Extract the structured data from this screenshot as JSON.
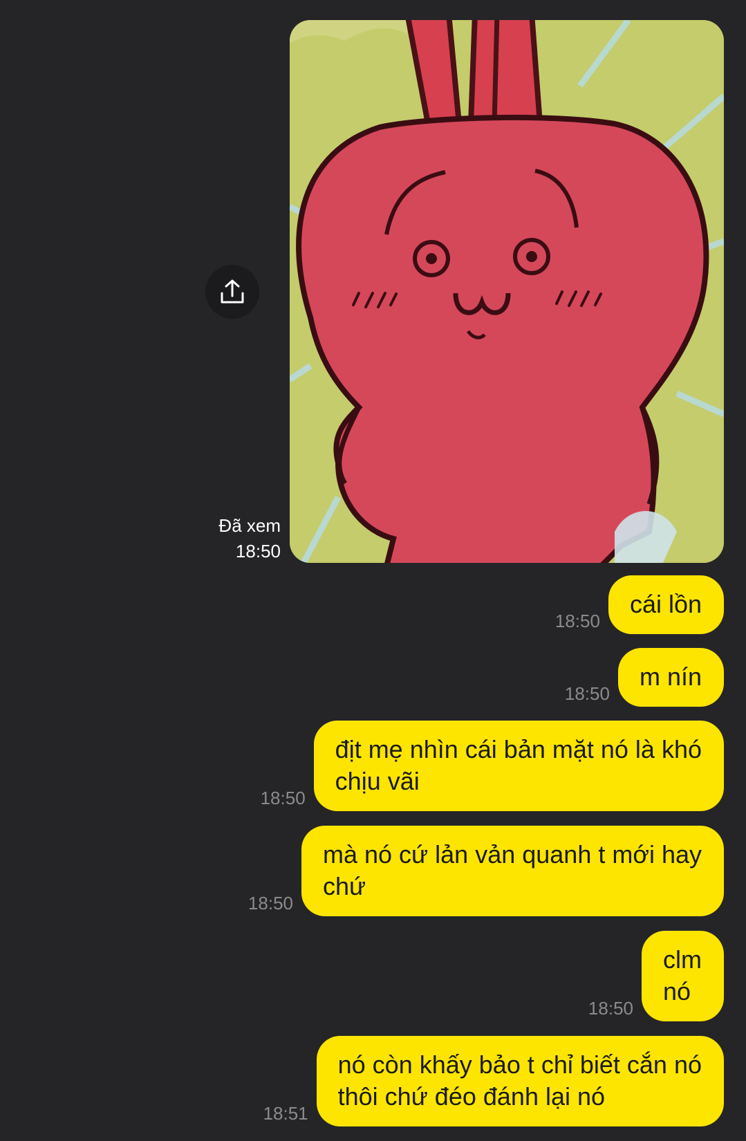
{
  "image_message": {
    "image_alt": "red cartoon bunny sticker on green background",
    "seen_label": "Đã xem",
    "time": "18:50"
  },
  "messages": [
    {
      "lines": [
        "cái lồn"
      ],
      "time": "18:50"
    },
    {
      "lines": [
        "m nín"
      ],
      "time": "18:50"
    },
    {
      "lines": [
        "địt mẹ nhìn cái bản mặt nó là khó",
        "chịu vãi"
      ],
      "time": "18:50"
    },
    {
      "lines": [
        "mà nó cứ lản vản quanh t mới hay",
        "chứ"
      ],
      "time": "18:50"
    },
    {
      "lines": [
        "clm",
        "nó"
      ],
      "time": "18:50"
    },
    {
      "lines": [
        "nó còn khấy bảo t chỉ biết cắn nó",
        "thôi chứ đéo đánh lại nó"
      ],
      "time": "18:51"
    }
  ],
  "icons": {
    "share": "share-upload-icon"
  },
  "colors": {
    "background": "#252527",
    "bubble": "#fee500",
    "time": "#8b8b8e"
  }
}
